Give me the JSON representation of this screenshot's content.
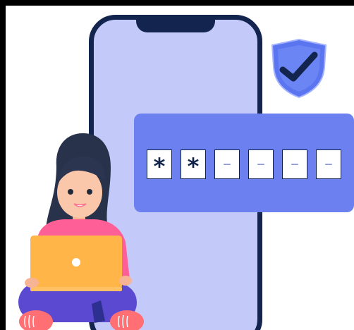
{
  "illustration": {
    "pin_entry": {
      "digits": [
        "*",
        "*",
        "–",
        "–",
        "–",
        "–"
      ]
    },
    "badge_icon": "shield-check-icon",
    "person_icon": "woman-with-laptop",
    "device_icon": "smartphone"
  },
  "colors": {
    "frame": "#000000",
    "background": "#ffffff",
    "phone_fill": "#c3caf9",
    "phone_border": "#13254f",
    "pin_card": "#6d80f0",
    "pin_box": "#ffffff",
    "pin_text": "#0f2248",
    "pin_empty": "#8f9ad9",
    "shield_blue": "#5b75f1",
    "checkmark": "#13254f",
    "laptop": "#ffb547",
    "shirt": "#ff5f97",
    "pants": "#5c49d1",
    "shoes": "#ff6f73"
  }
}
